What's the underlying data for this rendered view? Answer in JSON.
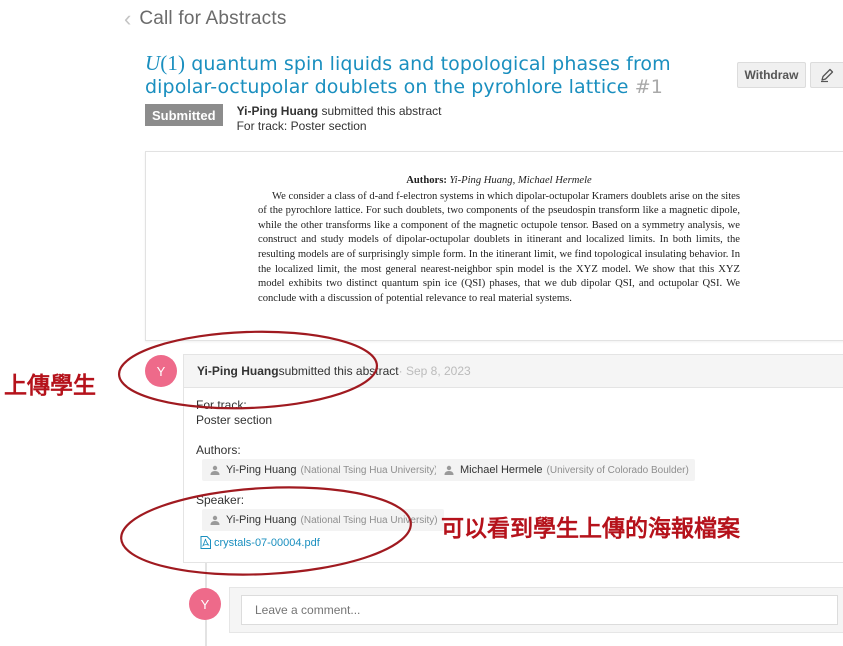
{
  "header": {
    "back_icon": "chevron-left-icon",
    "title": "Call for Abstracts"
  },
  "abstract": {
    "title_math": "U",
    "title_math_rest": "(1)",
    "title_text": " quantum spin liquids and topological phases from dipolar-octupolar doublets on the pyrohlore lattice ",
    "number": "#1",
    "withdraw_label": "Withdraw",
    "edit_icon": "pencil-icon",
    "status": "Submitted",
    "submitter": "Yi-Ping Huang",
    "submitted_text": " submitted this abstract",
    "track_line": "For track: Poster section",
    "authors_label": "Authors:",
    "authors_names": "Yi-Ping Huang, Michael Hermele",
    "body": "We consider a class of d-and f-electron systems in which dipolar-octupolar Kramers doublets arise on the sites of the pyrochlore lattice. For such doublets, two components of the pseudospin transform like a magnetic dipole, while the other transforms like a component of the magnetic octupole tensor. Based on a symmetry analysis, we construct and study models of dipolar-octupolar doublets in itinerant and localized limits. In both limits, the resulting models are of surprisingly simple form. In the itinerant limit, we find topological insulating behavior. In the localized limit, the most general nearest-neighbor spin model is the XYZ model. We show that this XYZ model exhibits two distinct quantum spin ice (QSI) phases, that we dub dipolar QSI, and octupolar QSI. We conclude with a discussion of potential relevance to real material systems."
  },
  "timeline": {
    "avatar_letter": "Y",
    "event_user": "Yi-Ping Huang",
    "event_text": " submitted this abstract",
    "event_date": " · Sep 8, 2023",
    "track_label": "For track:",
    "track_value": "Poster section",
    "authors_label": "Authors:",
    "authors": [
      {
        "name": "Yi-Ping Huang",
        "affiliation": "(National Tsing Hua University)"
      },
      {
        "name": "Michael Hermele",
        "affiliation": "(University of Colorado Boulder)"
      }
    ],
    "speaker_label": "Speaker:",
    "speaker": {
      "name": "Yi-Ping Huang",
      "affiliation": "(National Tsing Hua University)"
    },
    "attachment": "crystals-07-00004.pdf",
    "person_icon": "user-icon",
    "file_icon": "pdf-file-icon"
  },
  "comment": {
    "avatar_letter": "Y",
    "placeholder": "Leave a comment..."
  },
  "annotations": {
    "upload_student": "上傳學生",
    "see_poster": "可以看到學生上傳的海報檔案",
    "color": "#b5121b"
  },
  "colors": {
    "link": "#1a8fbf",
    "avatar": "#ee6a8a",
    "badge": "#8c8c8c"
  }
}
